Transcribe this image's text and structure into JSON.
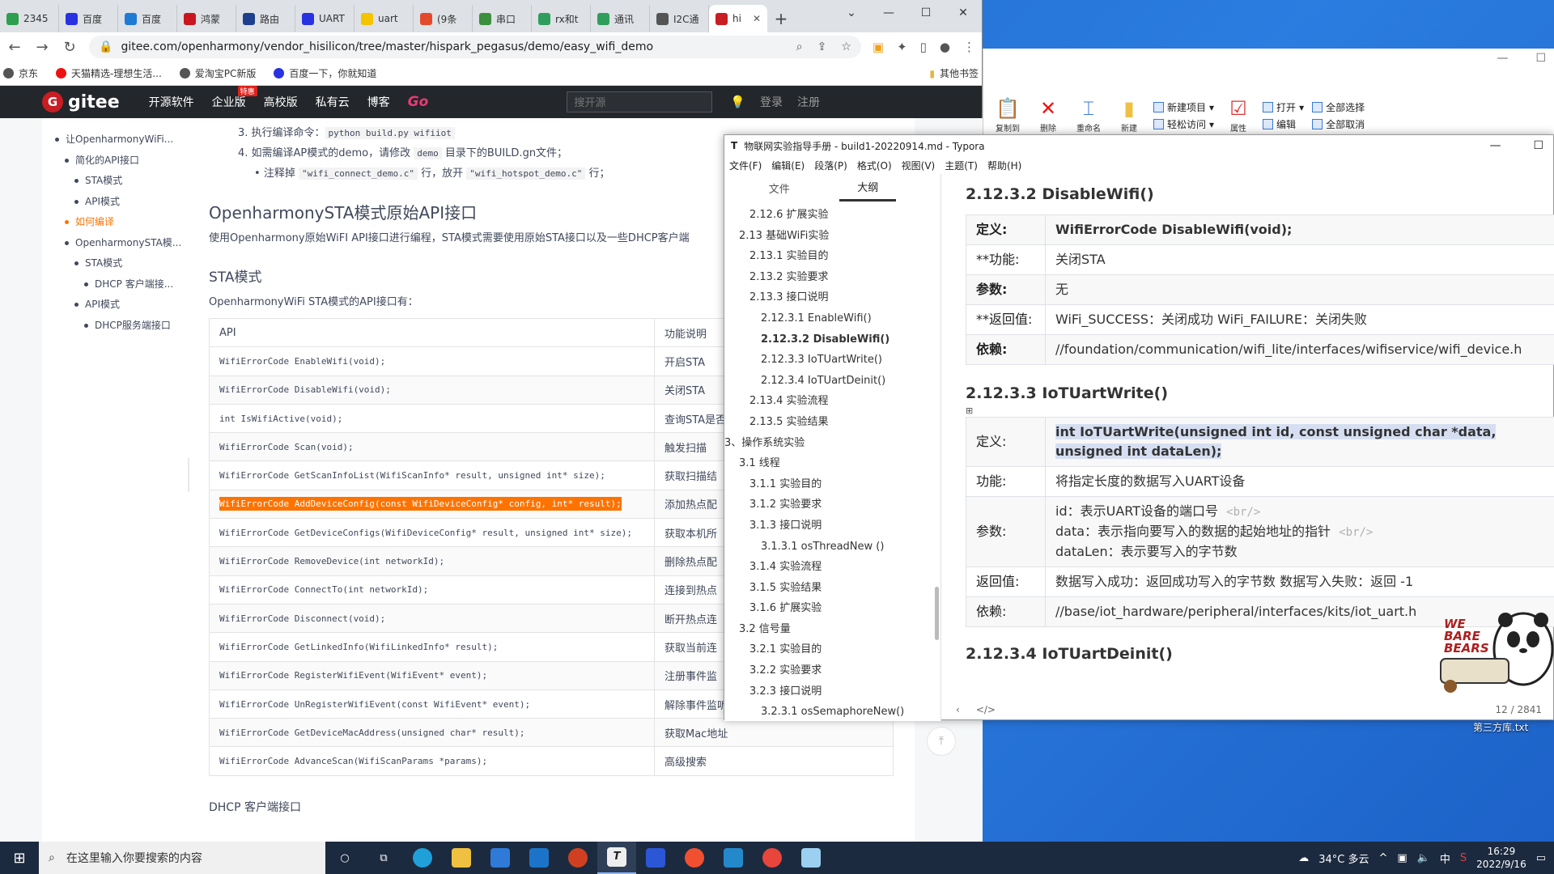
{
  "browser": {
    "tabs": [
      {
        "label": "2345",
        "color": "#2e9e4f"
      },
      {
        "label": "百度",
        "color": "#2932e1"
      },
      {
        "label": "百度",
        "color": "#1e7bd6"
      },
      {
        "label": "鸿蒙",
        "color": "#c9151e"
      },
      {
        "label": "路由",
        "color": "#1d3f8f"
      },
      {
        "label": "UART",
        "color": "#2932e1"
      },
      {
        "label": "uart",
        "color": "#f5c400"
      },
      {
        "label": "(9条",
        "color": "#e24a2b"
      },
      {
        "label": "串口",
        "color": "#3c8f3c"
      },
      {
        "label": "rx和t",
        "color": "#2f9e5c"
      },
      {
        "label": "通讯",
        "color": "#2f9e5c"
      },
      {
        "label": "I2C通",
        "color": "#555555"
      },
      {
        "label": "hi",
        "color": "#c71d23",
        "active": true
      }
    ],
    "new_tab": "+",
    "url": "gitee.com/openharmony/vendor_hisilicon/tree/master/hispark_pegasus/demo/easy_wifi_demo",
    "bookmarks": [
      "京东",
      "天猫精选-理想生活...",
      "爱淘宝PC新版",
      "百度一下，你就知道"
    ],
    "bookmarks_folder": "其他书签"
  },
  "gitee": {
    "logo": "gitee",
    "nav": [
      "开源软件",
      "企业版",
      "高校版",
      "私有云",
      "博客"
    ],
    "badge": "特惠",
    "go": "Go",
    "search_placeholder": "搜开源",
    "login": "登录",
    "register": "注册"
  },
  "toc": {
    "items": [
      {
        "label": "让OpenharmonyWiFi...",
        "level": 0
      },
      {
        "label": "简化的API接口",
        "level": 1
      },
      {
        "label": "STA模式",
        "level": 2
      },
      {
        "label": "API模式",
        "level": 2
      },
      {
        "label": "如何编译",
        "level": 1,
        "active": true
      },
      {
        "label": "OpenharmonySTA模...",
        "level": 1
      },
      {
        "label": "STA模式",
        "level": 2
      },
      {
        "label": "DHCP 客户端接...",
        "level": 3
      },
      {
        "label": "API模式",
        "level": 2
      },
      {
        "label": "DHCP服务端接口",
        "level": 3
      }
    ]
  },
  "doc": {
    "step3_prefix": "3. 执行编译命令：",
    "step3_code": "python build.py wifiiot",
    "step4_a": "4. 如需编译AP模式的demo，请修改 ",
    "step4_code": "demo",
    "step4_b": " 目录下的BUILD.gn文件；",
    "step4_sub_a": "注释掉 ",
    "step4_sub_code1": "\"wifi_connect_demo.c\"",
    "step4_sub_b": " 行，放开 ",
    "step4_sub_code2": "\"wifi_hotspot_demo.c\"",
    "step4_sub_c": " 行；",
    "h2": "OpenharmonySTA模式原始API接口",
    "para": "使用Openharmony原始WiFI API接口进行编程，STA模式需要使用原始STA接口以及一些DHCP客户端",
    "h3": "STA模式",
    "table_intro": "OpenharmonyWiFi STA模式的API接口有：",
    "table_headers": [
      "API",
      "功能说明"
    ],
    "table_rows": [
      [
        "WifiErrorCode EnableWifi(void);",
        "开启STA"
      ],
      [
        "WifiErrorCode DisableWifi(void);",
        "关闭STA"
      ],
      [
        "int IsWifiActive(void);",
        "查询STA是否"
      ],
      [
        "WifiErrorCode Scan(void);",
        "触发扫描"
      ],
      [
        "WifiErrorCode GetScanInfoList(WifiScanInfo* result, unsigned int* size);",
        "获取扫描结"
      ],
      [
        "WifiErrorCode AddDeviceConfig(const WifiDeviceConfig* config, int* result);",
        "添加热点配"
      ],
      [
        "WifiErrorCode GetDeviceConfigs(WifiDeviceConfig* result, unsigned int* size);",
        "获取本机所"
      ],
      [
        "WifiErrorCode RemoveDevice(int networkId);",
        "删除热点配"
      ],
      [
        "WifiErrorCode ConnectTo(int networkId);",
        "连接到热点"
      ],
      [
        "WifiErrorCode Disconnect(void);",
        "断开热点连"
      ],
      [
        "WifiErrorCode GetLinkedInfo(WifiLinkedInfo* result);",
        "获取当前连"
      ],
      [
        "WifiErrorCode RegisterWifiEvent(WifiEvent* event);",
        "注册事件监"
      ],
      [
        "WifiErrorCode UnRegisterWifiEvent(const WifiEvent* event);",
        "解除事件监听"
      ],
      [
        "WifiErrorCode GetDeviceMacAddress(unsigned char* result);",
        "获取Mac地址"
      ],
      [
        "WifiErrorCode AdvanceScan(WifiScanParams *params);",
        "高级搜索"
      ]
    ],
    "highlight_row": 5,
    "dhcp_heading": "DHCP 客户端接口"
  },
  "typora": {
    "title": "物联网实验指导手册 - build1-20220914.md - Typora",
    "menu": [
      "文件(F)",
      "编辑(E)",
      "段落(P)",
      "格式(O)",
      "视图(V)",
      "主题(T)",
      "帮助(H)"
    ],
    "side_tabs": [
      "文件",
      "大纲"
    ],
    "outline": [
      {
        "t": "2.12.6 扩展实验",
        "l": "l2"
      },
      {
        "t": "2.13 基础WiFi实验",
        "l": "l1"
      },
      {
        "t": "2.13.1 实验目的",
        "l": "l2"
      },
      {
        "t": "2.13.2 实验要求",
        "l": "l2"
      },
      {
        "t": "2.13.3 接口说明",
        "l": "l2"
      },
      {
        "t": "2.12.3.1 EnableWifi()",
        "l": "l3"
      },
      {
        "t": "2.12.3.2 DisableWifi()",
        "l": "l3",
        "b": true
      },
      {
        "t": "2.12.3.3 IoTUartWrite()",
        "l": "l3"
      },
      {
        "t": "2.12.3.4 IoTUartDeinit()",
        "l": "l3"
      },
      {
        "t": "2.13.4 实验流程",
        "l": "l2"
      },
      {
        "t": "2.13.5 实验结果",
        "l": "l2"
      },
      {
        "t": "3、操作系统实验",
        "l": "l0"
      },
      {
        "t": "3.1 线程",
        "l": "l1"
      },
      {
        "t": "3.1.1 实验目的",
        "l": "l2"
      },
      {
        "t": "3.1.2 实验要求",
        "l": "l2"
      },
      {
        "t": "3.1.3 接口说明",
        "l": "l2"
      },
      {
        "t": "3.1.3.1 osThreadNew ()",
        "l": "l3"
      },
      {
        "t": "3.1.4 实验流程",
        "l": "l2"
      },
      {
        "t": "3.1.5 实验结果",
        "l": "l2"
      },
      {
        "t": "3.1.6 扩展实验",
        "l": "l2"
      },
      {
        "t": "3.2 信号量",
        "l": "l1"
      },
      {
        "t": "3.2.1 实验目的",
        "l": "l2"
      },
      {
        "t": "3.2.2 实验要求",
        "l": "l2"
      },
      {
        "t": "3.2.3 接口说明",
        "l": "l2"
      },
      {
        "t": "3.2.3.1 osSemaphoreNew()",
        "l": "l3"
      }
    ],
    "s1": {
      "h": "2.12.3.2 DisableWifi()",
      "rows": [
        [
          "定义:",
          "WifiErrorCode DisableWifi(void);"
        ],
        [
          "**功能:",
          "关闭STA"
        ],
        [
          "参数:",
          "无"
        ],
        [
          "**返回值:",
          "WiFi_SUCCESS：关闭成功    WiFi_FAILURE：关闭失败"
        ],
        [
          "依赖:",
          "//foundation/communication/wifi_lite/interfaces/wifiservice/wifi_device.h"
        ]
      ]
    },
    "s2": {
      "h": "2.12.3.3 IoTUartWrite()",
      "def_k": "定义:",
      "def_v": "int   IoTUartWrite(unsigned int id, const unsigned char *data, unsigned int dataLen);",
      "func_k": "功能:",
      "func_v": "将指定长度的数据写入UART设备",
      "param_k": "参数:",
      "param_1": "id：表示UART设备的端口号",
      "param_2": "data：表示指向要写入的数据的起始地址的指针",
      "param_3": "dataLen：表示要写入的字节数",
      "br": "<br/>",
      "ret_k": "返回值:",
      "ret_v": "数据写入成功：返回成功写入的字节数    数据写入失败：返回 -1",
      "dep_k": "依赖:",
      "dep_v": "//base/iot_hardware/peripheral/interfaces/kits/iot_uart.h"
    },
    "s3_h": "2.12.3.4 IoTUartDeinit()",
    "word_count": "12 / 2841"
  },
  "explorer": {
    "buttons": [
      "复制到",
      "删除",
      "重命名",
      "新建",
      "属性"
    ],
    "new_item": "新建项目",
    "easy_access": "轻松访问",
    "open": "打开",
    "edit": "编辑",
    "select_all": "全部选择",
    "select_none": "全部取消"
  },
  "desktop": {
    "file": "第三方库.txt",
    "sticker": "WE BARE BEARS"
  },
  "taskbar": {
    "search_placeholder": "在这里输入你要搜索的内容",
    "weather": "34°C 多云",
    "time": "16:29",
    "date": "2022/9/16",
    "ime": "中"
  }
}
